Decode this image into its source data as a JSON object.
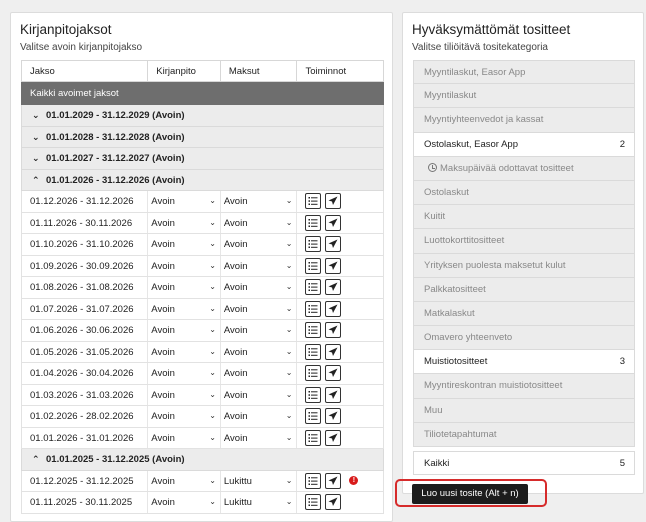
{
  "left": {
    "title": "Kirjanpitojaksot",
    "subtitle": "Valitse avoin kirjanpitojakso",
    "headers": [
      "Jakso",
      "Kirjanpito",
      "Maksut",
      "Toiminnot"
    ],
    "all_open": "Kaikki avoimet jaksot",
    "years_collapsed": [
      "01.01.2029 - 31.12.2029 (Avoin)",
      "01.01.2028 - 31.12.2028 (Avoin)",
      "01.01.2027 - 31.12.2027 (Avoin)"
    ],
    "year_expanded": "01.01.2026 - 31.12.2026 (Avoin)",
    "periods_2026": [
      {
        "period": "01.12.2026 - 31.12.2026",
        "bookkeeping": "Avoin",
        "payments": "Avoin"
      },
      {
        "period": "01.11.2026 - 30.11.2026",
        "bookkeeping": "Avoin",
        "payments": "Avoin"
      },
      {
        "period": "01.10.2026 - 31.10.2026",
        "bookkeeping": "Avoin",
        "payments": "Avoin"
      },
      {
        "period": "01.09.2026 - 30.09.2026",
        "bookkeeping": "Avoin",
        "payments": "Avoin"
      },
      {
        "period": "01.08.2026 - 31.08.2026",
        "bookkeeping": "Avoin",
        "payments": "Avoin"
      },
      {
        "period": "01.07.2026 - 31.07.2026",
        "bookkeeping": "Avoin",
        "payments": "Avoin"
      },
      {
        "period": "01.06.2026 - 30.06.2026",
        "bookkeeping": "Avoin",
        "payments": "Avoin"
      },
      {
        "period": "01.05.2026 - 31.05.2026",
        "bookkeeping": "Avoin",
        "payments": "Avoin"
      },
      {
        "period": "01.04.2026 - 30.04.2026",
        "bookkeeping": "Avoin",
        "payments": "Avoin"
      },
      {
        "period": "01.03.2026 - 31.03.2026",
        "bookkeeping": "Avoin",
        "payments": "Avoin"
      },
      {
        "period": "01.02.2026 - 28.02.2026",
        "bookkeeping": "Avoin",
        "payments": "Avoin"
      },
      {
        "period": "01.01.2026 - 31.01.2026",
        "bookkeeping": "Avoin",
        "payments": "Avoin"
      }
    ],
    "year_2025": "01.01.2025 - 31.12.2025 (Avoin)",
    "periods_2025": [
      {
        "period": "01.12.2025 - 31.12.2025",
        "bookkeeping": "Avoin",
        "payments": "Lukittu"
      },
      {
        "period": "01.11.2025 - 30.11.2025",
        "bookkeeping": "Avoin",
        "payments": "Lukittu"
      }
    ]
  },
  "right": {
    "title": "Hyväksymättömät tositteet",
    "subtitle": "Valitse tiliöitävä tositekategoria",
    "categories": [
      {
        "label": "Myyntilaskut, Easor App",
        "count": "",
        "active": false
      },
      {
        "label": "Myyntilaskut",
        "count": "",
        "active": false
      },
      {
        "label": "Myyntiyhteenvedot ja kassat",
        "count": "",
        "active": false
      },
      {
        "label": "Ostolaskut, Easor App",
        "count": "2",
        "active": true
      },
      {
        "label": "Maksupäivää odottavat tositteet",
        "count": "",
        "active": false,
        "sub": true
      },
      {
        "label": "Ostolaskut",
        "count": "",
        "active": false
      },
      {
        "label": "Kuitit",
        "count": "",
        "active": false
      },
      {
        "label": "Luottokorttitositteet",
        "count": "",
        "active": false
      },
      {
        "label": "Yrityksen puolesta maksetut kulut",
        "count": "",
        "active": false
      },
      {
        "label": "Palkkatositteet",
        "count": "",
        "active": false
      },
      {
        "label": "Matkalaskut",
        "count": "",
        "active": false
      },
      {
        "label": "Omavero yhteenveto",
        "count": "",
        "active": false
      },
      {
        "label": "Muistiotositteet",
        "count": "3",
        "active": true
      },
      {
        "label": "Myyntireskontran muistiotositteet",
        "count": "",
        "active": false
      },
      {
        "label": "Muu",
        "count": "",
        "active": false
      },
      {
        "label": "Tiliotetapahtumat",
        "count": "",
        "active": false
      }
    ],
    "total_label": "Kaikki",
    "total_count": "5"
  },
  "new_voucher_button": "Luo uusi tosite (Alt + n)"
}
